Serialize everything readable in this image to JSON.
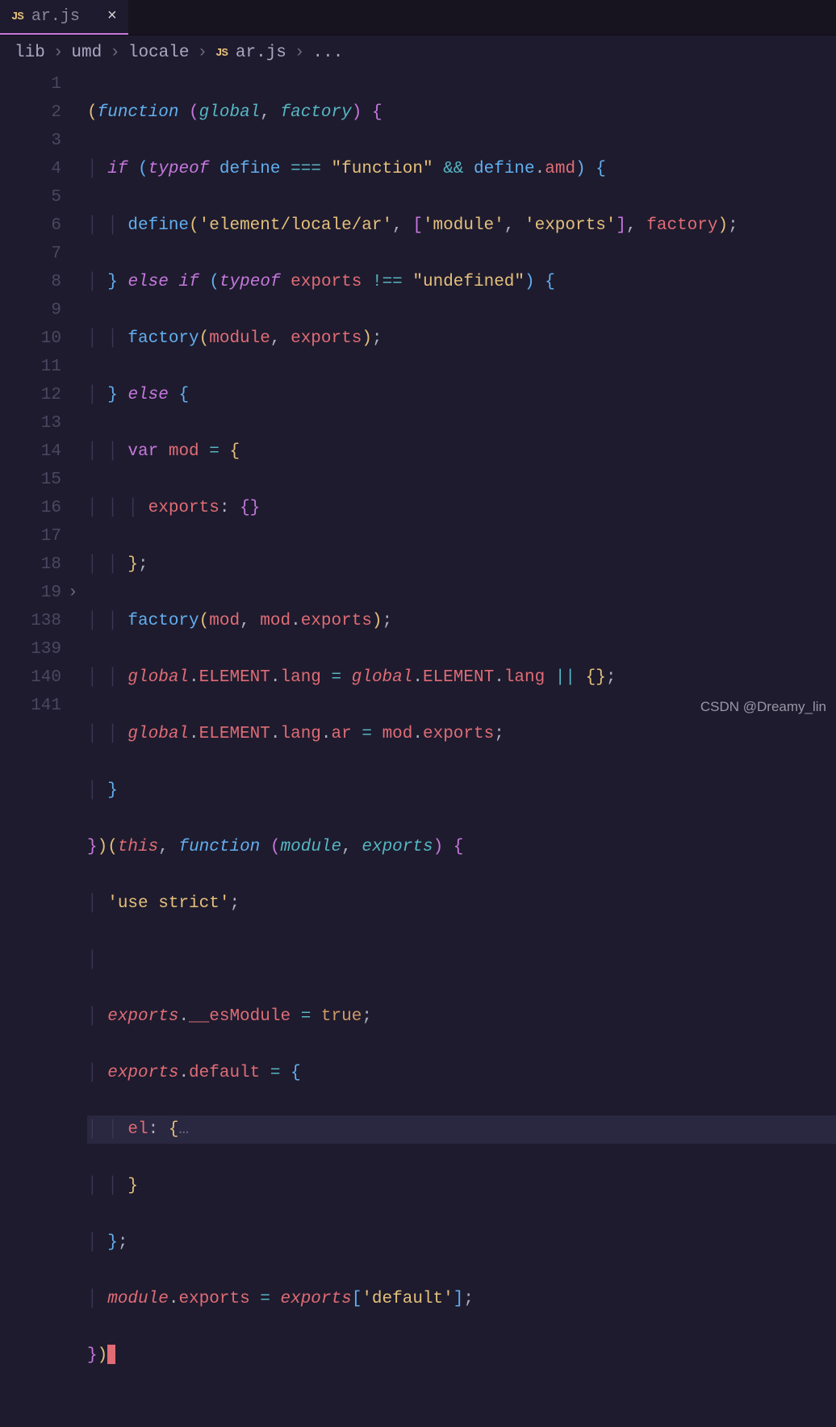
{
  "tab": {
    "lang_badge": "JS",
    "filename": "ar.js",
    "close_glyph": "×"
  },
  "breadcrumb": {
    "seg1": "lib",
    "seg2": "umd",
    "seg3": "locale",
    "badge": "JS",
    "file": "ar.js",
    "tail": "...",
    "chevron": "›"
  },
  "line_numbers": [
    "1",
    "2",
    "3",
    "4",
    "5",
    "6",
    "7",
    "8",
    "9",
    "10",
    "11",
    "12",
    "13",
    "14",
    "15",
    "16",
    "17",
    "18",
    "19",
    "138",
    "139",
    "140",
    "141"
  ],
  "fold_row_index": 18,
  "fold_glyph": "›",
  "code": {
    "l1": {
      "kw_function": "function",
      "p_global": "global",
      "p_factory": "factory"
    },
    "l2": {
      "kw_if": "if",
      "kw_typeof": "typeof",
      "id_define": "define",
      "op_eq": "===",
      "str_function": "\"function\"",
      "op_and": "&&",
      "id_define2": "define",
      "prop_amd": "amd"
    },
    "l3": {
      "id_define": "define",
      "str_path": "'element/locale/ar'",
      "str_module": "'module'",
      "str_exports": "'exports'",
      "id_factory": "factory"
    },
    "l4": {
      "kw_else": "else",
      "kw_if": "if",
      "kw_typeof": "typeof",
      "id_exports": "exports",
      "op_neq": "!==",
      "str_undef": "\"undefined\""
    },
    "l5": {
      "id_factory": "factory",
      "id_module": "module",
      "id_exports": "exports"
    },
    "l6": {
      "kw_else": "else"
    },
    "l7": {
      "kw_var": "var",
      "id_mod": "mod"
    },
    "l8": {
      "prop_exports": "exports"
    },
    "l10": {
      "id_factory": "factory",
      "id_mod": "mod",
      "id_mod2": "mod",
      "prop_exports": "exports"
    },
    "l11": {
      "id_global": "global",
      "prop_element": "ELEMENT",
      "prop_lang": "lang",
      "id_global2": "global",
      "prop_element2": "ELEMENT",
      "prop_lang2": "lang",
      "op_or": "||"
    },
    "l12": {
      "id_global": "global",
      "prop_element": "ELEMENT",
      "prop_lang": "lang",
      "prop_ar": "ar",
      "id_mod": "mod",
      "prop_exports": "exports"
    },
    "l14": {
      "kw_this": "this",
      "kw_function": "function",
      "p_module": "module",
      "p_exports": "exports"
    },
    "l15": {
      "str_use_strict": "'use strict'"
    },
    "l17": {
      "id_exports": "exports",
      "prop_esmodule": "__esModule",
      "val_true": "true"
    },
    "l18": {
      "id_exports": "exports",
      "prop_default": "default"
    },
    "l19": {
      "prop_el": "el",
      "fold": "…"
    },
    "l140": {
      "id_module": "module",
      "prop_exports": "exports",
      "id_exports2": "exports",
      "str_default": "'default'"
    }
  },
  "watermark": "CSDN @Dreamy_lin"
}
